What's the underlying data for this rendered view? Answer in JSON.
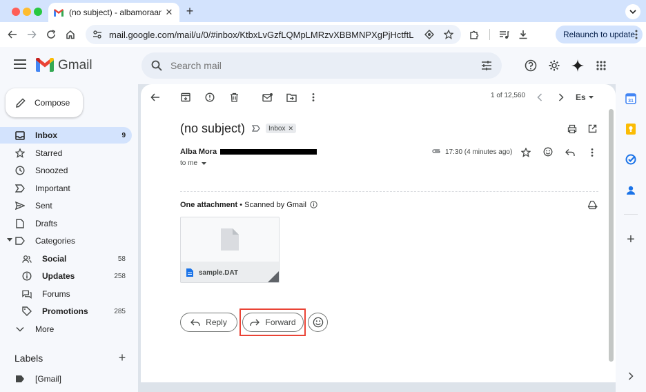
{
  "browser": {
    "tab_title": "(no subject) - albamoraantoja",
    "url": "mail.google.com/mail/u/0/#inbox/KtbxLvGzfLQMpLMRzvXBBMNPXgPjHctftL",
    "relaunch_label": "Relaunch to update"
  },
  "gmail": {
    "brand": "Gmail",
    "search_placeholder": "Search mail"
  },
  "sidebar": {
    "compose_label": "Compose",
    "items": [
      {
        "label": "Inbox",
        "count": "9",
        "icon": "inbox-icon"
      },
      {
        "label": "Starred",
        "count": "",
        "icon": "star-icon"
      },
      {
        "label": "Snoozed",
        "count": "",
        "icon": "clock-icon"
      },
      {
        "label": "Important",
        "count": "",
        "icon": "important-icon"
      },
      {
        "label": "Sent",
        "count": "",
        "icon": "send-icon"
      },
      {
        "label": "Drafts",
        "count": "",
        "icon": "draft-icon"
      },
      {
        "label": "Categories",
        "count": "",
        "icon": "label-icon"
      },
      {
        "label": "Social",
        "count": "58",
        "icon": "people-icon"
      },
      {
        "label": "Updates",
        "count": "258",
        "icon": "info-icon"
      },
      {
        "label": "Forums",
        "count": "",
        "icon": "forum-icon"
      },
      {
        "label": "Promotions",
        "count": "285",
        "icon": "tag-icon"
      },
      {
        "label": "More",
        "count": "",
        "icon": "chevron-down-icon"
      }
    ],
    "labels_title": "Labels",
    "label_items": [
      "[Gmail]"
    ]
  },
  "toolbar": {
    "pager": "1 of 12,560",
    "input_tool": "Es"
  },
  "email": {
    "subject": "(no subject)",
    "chip": "Inbox",
    "sender": "Alba Mora",
    "to": "to me",
    "time": "17:30 (4 minutes ago)",
    "attachment_title": "One attachment",
    "scanned": "• Scanned by Gmail",
    "file_name": "sample.DAT",
    "reply_label": "Reply",
    "forward_label": "Forward"
  },
  "colors": {
    "tab_strip": "#d3e3fd",
    "active_nav": "#d3e3fd",
    "highlight_box": "#ea4335"
  }
}
